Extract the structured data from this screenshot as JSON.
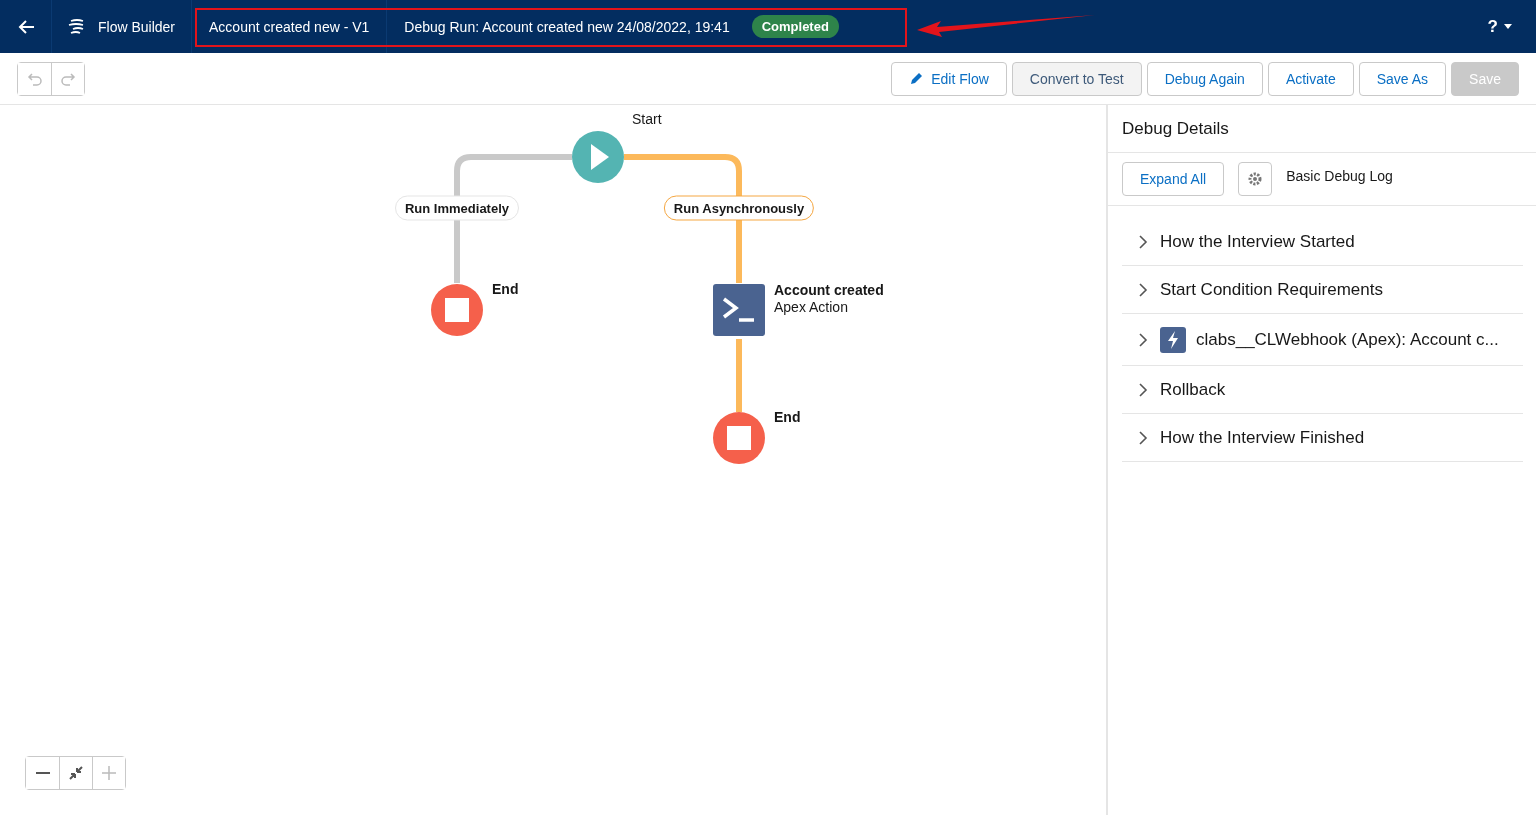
{
  "header": {
    "app_name": "Flow Builder",
    "flow_name": "Account created new - V1",
    "run_title": "Debug Run: Account created new 24/08/2022, 19:41",
    "status": "Completed",
    "help": "?"
  },
  "toolbar": {
    "buttons": [
      {
        "label": "Edit Flow",
        "kind": "edit",
        "disabled": false
      },
      {
        "label": "Convert to Test",
        "kind": "shaded",
        "disabled": false
      },
      {
        "label": "Debug Again",
        "kind": "plain",
        "disabled": false
      },
      {
        "label": "Activate",
        "kind": "plain",
        "disabled": false
      },
      {
        "label": "Save As",
        "kind": "plain",
        "disabled": false
      },
      {
        "label": "Save",
        "kind": "plain",
        "disabled": true
      }
    ]
  },
  "canvas": {
    "start": {
      "label": "Start"
    },
    "branches": [
      {
        "label": "Run Immediately",
        "kind": "grey",
        "end": "End"
      },
      {
        "label": "Run Asynchronously",
        "kind": "active",
        "action": {
          "title": "Account created",
          "subtitle": "Apex Action"
        },
        "end": "End"
      }
    ]
  },
  "debug_panel": {
    "title": "Debug Details",
    "expand_button": "Expand All",
    "log_level": "Basic Debug Log",
    "items": [
      {
        "label": "How the Interview Started",
        "kind": "plain",
        "expanded": false
      },
      {
        "label": "Start Condition Requirements",
        "kind": "plain",
        "expanded": false
      },
      {
        "label": "clabs__CLWebhook (Apex): Account c...",
        "kind": "apex",
        "expanded": false
      },
      {
        "label": "Rollback",
        "kind": "plain",
        "expanded": false
      },
      {
        "label": "How the Interview Finished",
        "kind": "plain",
        "expanded": false
      }
    ]
  }
}
